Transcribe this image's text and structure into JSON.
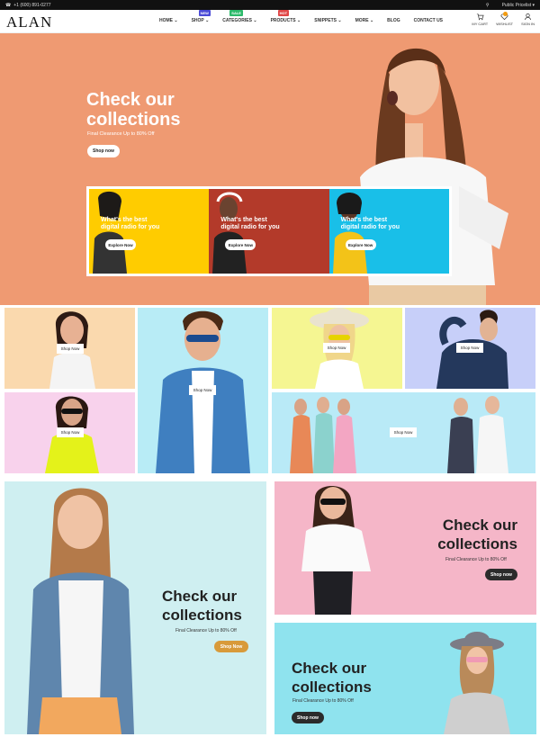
{
  "topbar": {
    "phone": "+1 (600) 891-0277",
    "currency": "Public Pricelist"
  },
  "brand": {
    "logo": "ALAN"
  },
  "menu": [
    {
      "label": "HOME",
      "badge": "",
      "badge_color": ""
    },
    {
      "label": "SHOP",
      "badge": "NEW",
      "badge_color": "#4a4ad6"
    },
    {
      "label": "CATEGORIES",
      "badge": "SALE",
      "badge_color": "#2cba6a"
    },
    {
      "label": "PRODUCTS",
      "badge": "HOT",
      "badge_color": "#e04646"
    },
    {
      "label": "SNIPPETS",
      "badge": "",
      "badge_color": ""
    },
    {
      "label": "MORE",
      "badge": "",
      "badge_color": ""
    },
    {
      "label": "BLOG",
      "badge": "",
      "badge_color": ""
    },
    {
      "label": "CONTACT US",
      "badge": "",
      "badge_color": ""
    }
  ],
  "actions": {
    "cart": "MY CART",
    "wishlist": "WISHLIST",
    "signin": "SIGN IN"
  },
  "hero": {
    "title_line1": "Check our",
    "title_line2": "collections",
    "subtitle": "Final Clearance Up to 80% Off",
    "button": "Shop now",
    "boxes": [
      {
        "line1": "What's the best",
        "line2": "digital radio for you",
        "button": "Explore Now",
        "color": "#ffcc00"
      },
      {
        "line1": "What's the best",
        "line2": "digital radio for you",
        "button": "Explore Now",
        "color": "#b33a2a"
      },
      {
        "line1": "What's the best",
        "line2": "digital radio for you",
        "button": "Explore Now",
        "color": "#19bfe8"
      }
    ]
  },
  "grid": {
    "shop_label": "Shop Now"
  },
  "promos": [
    {
      "title_line1": "Check our",
      "title_line2": "collections",
      "subtitle": "Final Clearance Up to 80% Off",
      "button": "Shop Now"
    },
    {
      "title_line1": "Check our",
      "title_line2": "collections",
      "subtitle": "Final Clearance Up to 80% Off",
      "button": "Shop now"
    },
    {
      "title_line1": "Check our",
      "title_line2": "collections",
      "subtitle": "Final Clearance Up to 80% Off",
      "button": "Shop now"
    }
  ]
}
